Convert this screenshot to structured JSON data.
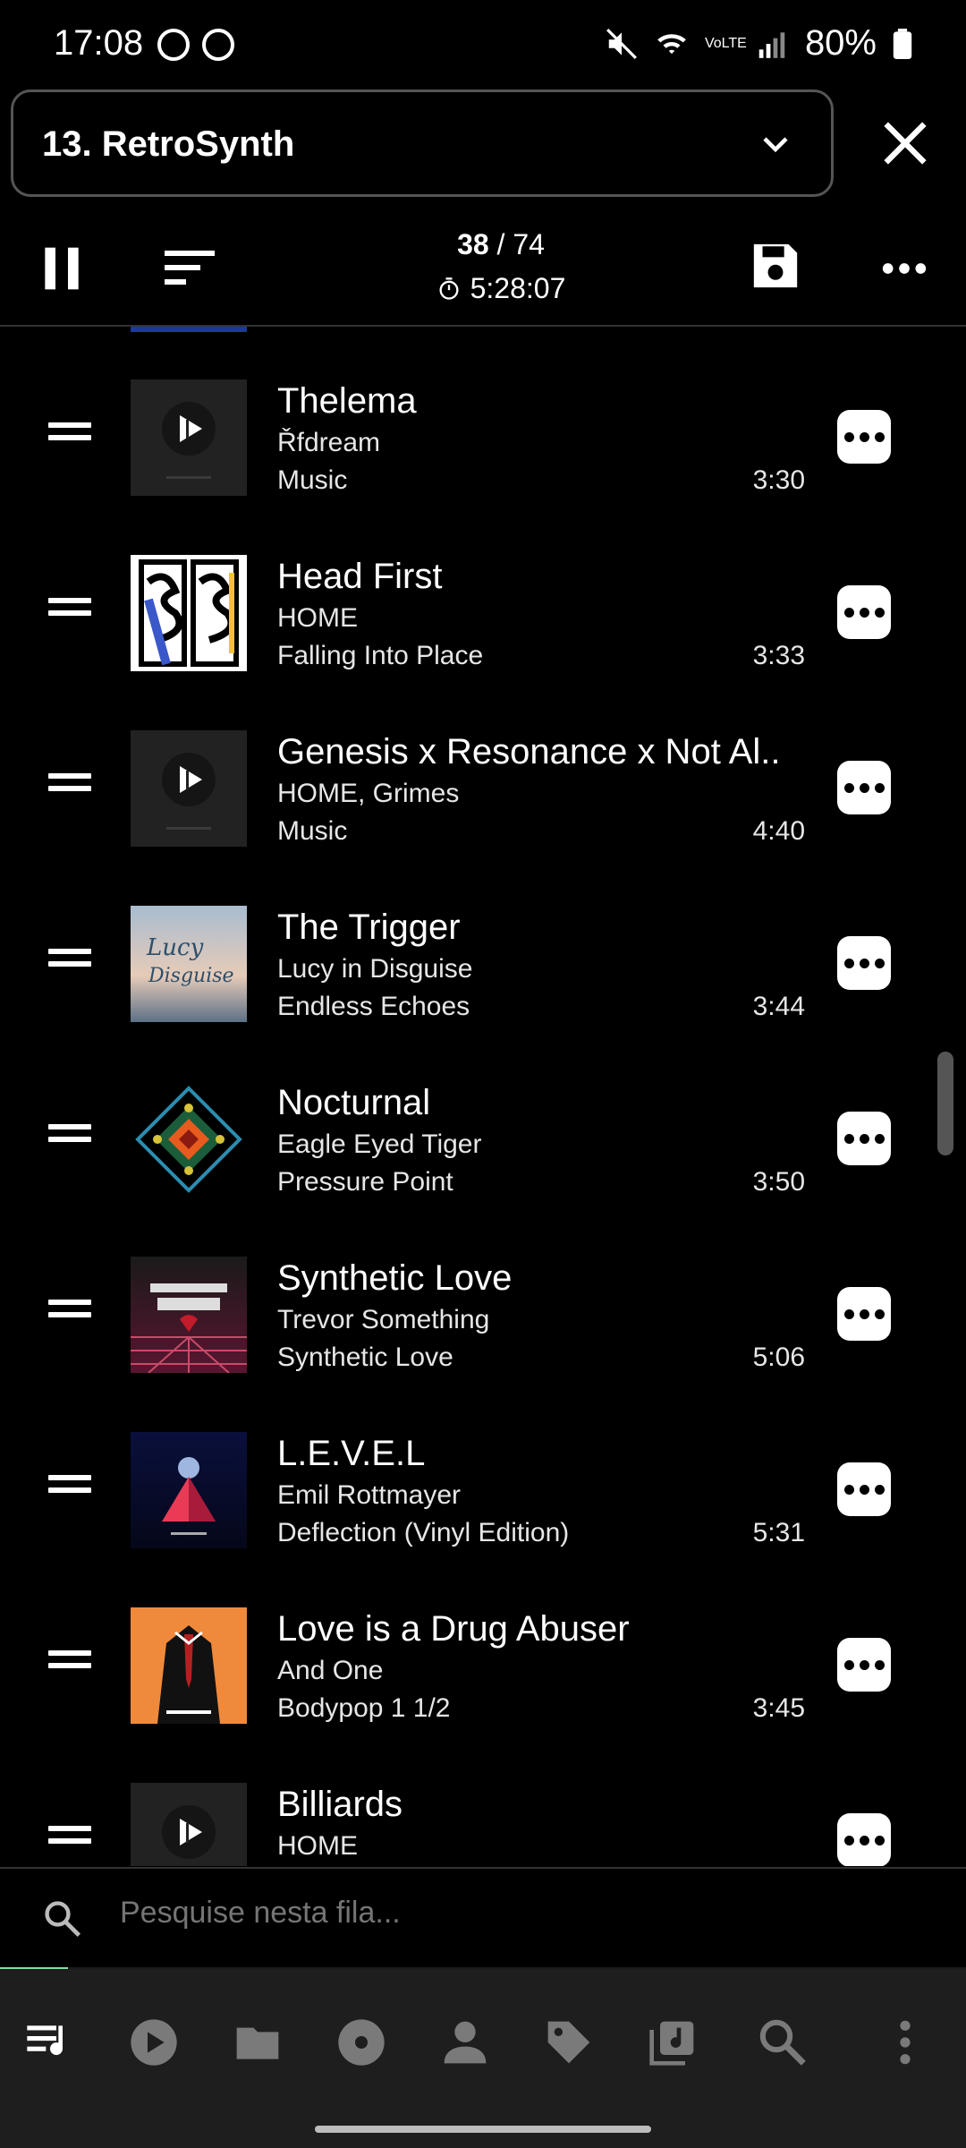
{
  "status_bar": {
    "time": "17:08",
    "battery": "80%",
    "network": "VoLTE"
  },
  "header": {
    "queue_name": "13. RetroSynth"
  },
  "toolbar": {
    "position": "38",
    "separator": "/",
    "total": "74",
    "total_duration": "5:28:07"
  },
  "tracks": [
    {
      "title": "Thelema",
      "artist": "Řfdream",
      "album": "Music",
      "duration": "3:30",
      "art": "default-note"
    },
    {
      "title": "Head First",
      "artist": "HOME",
      "album": "Falling Into Place",
      "duration": "3:33",
      "art": "head-first"
    },
    {
      "title": "Genesis x Resonance x Not Al..",
      "artist": "HOME, Grimes",
      "album": "Music",
      "duration": "4:40",
      "art": "default-note"
    },
    {
      "title": "The Trigger",
      "artist": "Lucy in Disguise",
      "album": "Endless Echoes",
      "duration": "3:44",
      "art": "lucy"
    },
    {
      "title": "Nocturnal",
      "artist": "Eagle Eyed Tiger",
      "album": "Pressure Point",
      "duration": "3:50",
      "art": "diamond"
    },
    {
      "title": "Synthetic Love",
      "artist": "Trevor Something",
      "album": "Synthetic Love",
      "duration": "5:06",
      "art": "synthetic-love"
    },
    {
      "title": "L.E.V.E.L",
      "artist": "Emil Rottmayer",
      "album": "Deflection (Vinyl Edition)",
      "duration": "5:31",
      "art": "deflection"
    },
    {
      "title": "Love is a Drug Abuser",
      "artist": "And One",
      "album": "Bodypop 1 1/2",
      "duration": "3:45",
      "art": "bodypop"
    },
    {
      "title": "Billiards",
      "artist": "HOME",
      "album": "",
      "duration": "",
      "art": "default-note"
    }
  ],
  "search": {
    "placeholder": "Pesquise nesta fila..."
  },
  "progress": {
    "fraction": 0.07
  },
  "nav": [
    "queue-icon",
    "play-icon",
    "folder-icon",
    "album-icon",
    "artist-icon",
    "tag-icon",
    "playlist-icon",
    "search-icon",
    "more-vert-icon"
  ],
  "colors": {
    "background": "#000000",
    "accent": "#7ee0a3",
    "nav_bg": "#1e1e1e"
  }
}
